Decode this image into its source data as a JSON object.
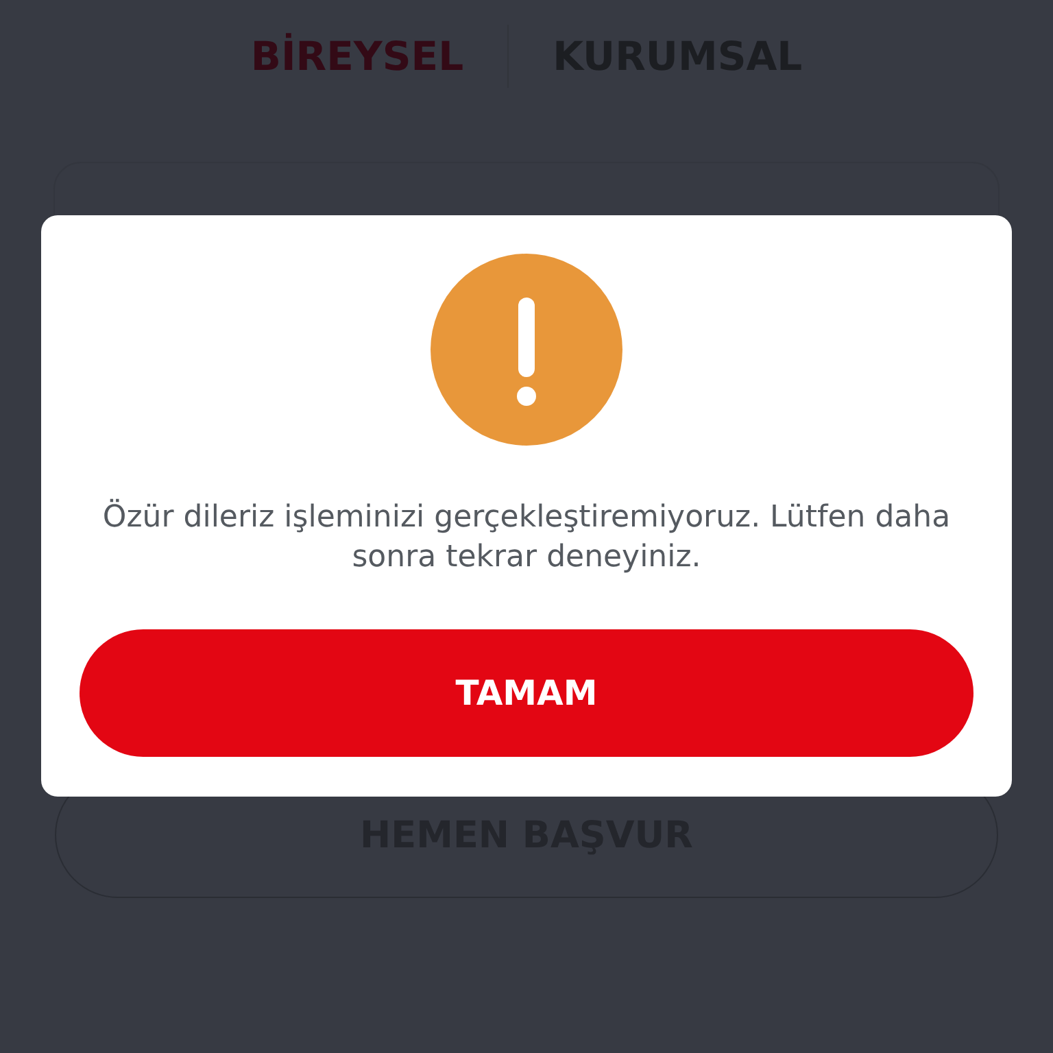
{
  "tabs": [
    {
      "label": "BİREYSEL",
      "selected": true
    },
    {
      "label": "KURUMSAL",
      "selected": false
    }
  ],
  "apply_button": {
    "label": "HEMEN BAŞVUR"
  },
  "dialog": {
    "kind": "warning",
    "message": "Özür dileriz işleminizi gerçekleştiremiyoruz. Lütfen daha sonra tekrar deneyiniz.",
    "button": "TAMAM"
  }
}
